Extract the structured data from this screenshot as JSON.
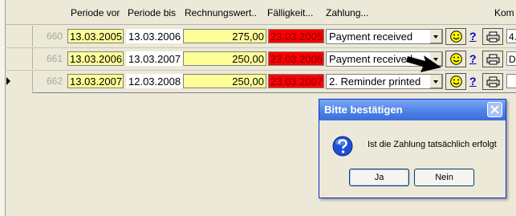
{
  "columns": [
    "Periode vor",
    "Periode bis",
    "Rechnungswert..",
    "Fälligkeit...",
    "Zahlung...",
    "Kom"
  ],
  "rows": [
    {
      "id": "660",
      "periode_vor": "13.03.2005",
      "periode_bis": "13.03.2006",
      "rechnungswert": "275,00",
      "faelligkeit": "23.03.2005",
      "zahlung": "Payment received",
      "edge": "4."
    },
    {
      "id": "661",
      "periode_vor": "13.03.2006",
      "periode_bis": "13.03.2007",
      "rechnungswert": "250,00",
      "faelligkeit": "23.03.2006",
      "zahlung": "Payment received",
      "edge": "DD"
    },
    {
      "id": "662",
      "periode_vor": "13.03.2007",
      "periode_bis": "12.03.2008",
      "rechnungswert": "250,00",
      "faelligkeit": "23.03.2007",
      "zahlung": "2. Reminder printed",
      "edge": ""
    }
  ],
  "help_link": "?",
  "dialog": {
    "title": "Bitte bestätigen",
    "message": "Ist die Zahlung tatsächlich erfolgt",
    "yes_label": "Ja",
    "no_label": "Nein"
  },
  "colors": {
    "due_date_bg": "#ff0000",
    "period_bg": "#ffff99",
    "dialog_title": "#3a6fdc"
  }
}
